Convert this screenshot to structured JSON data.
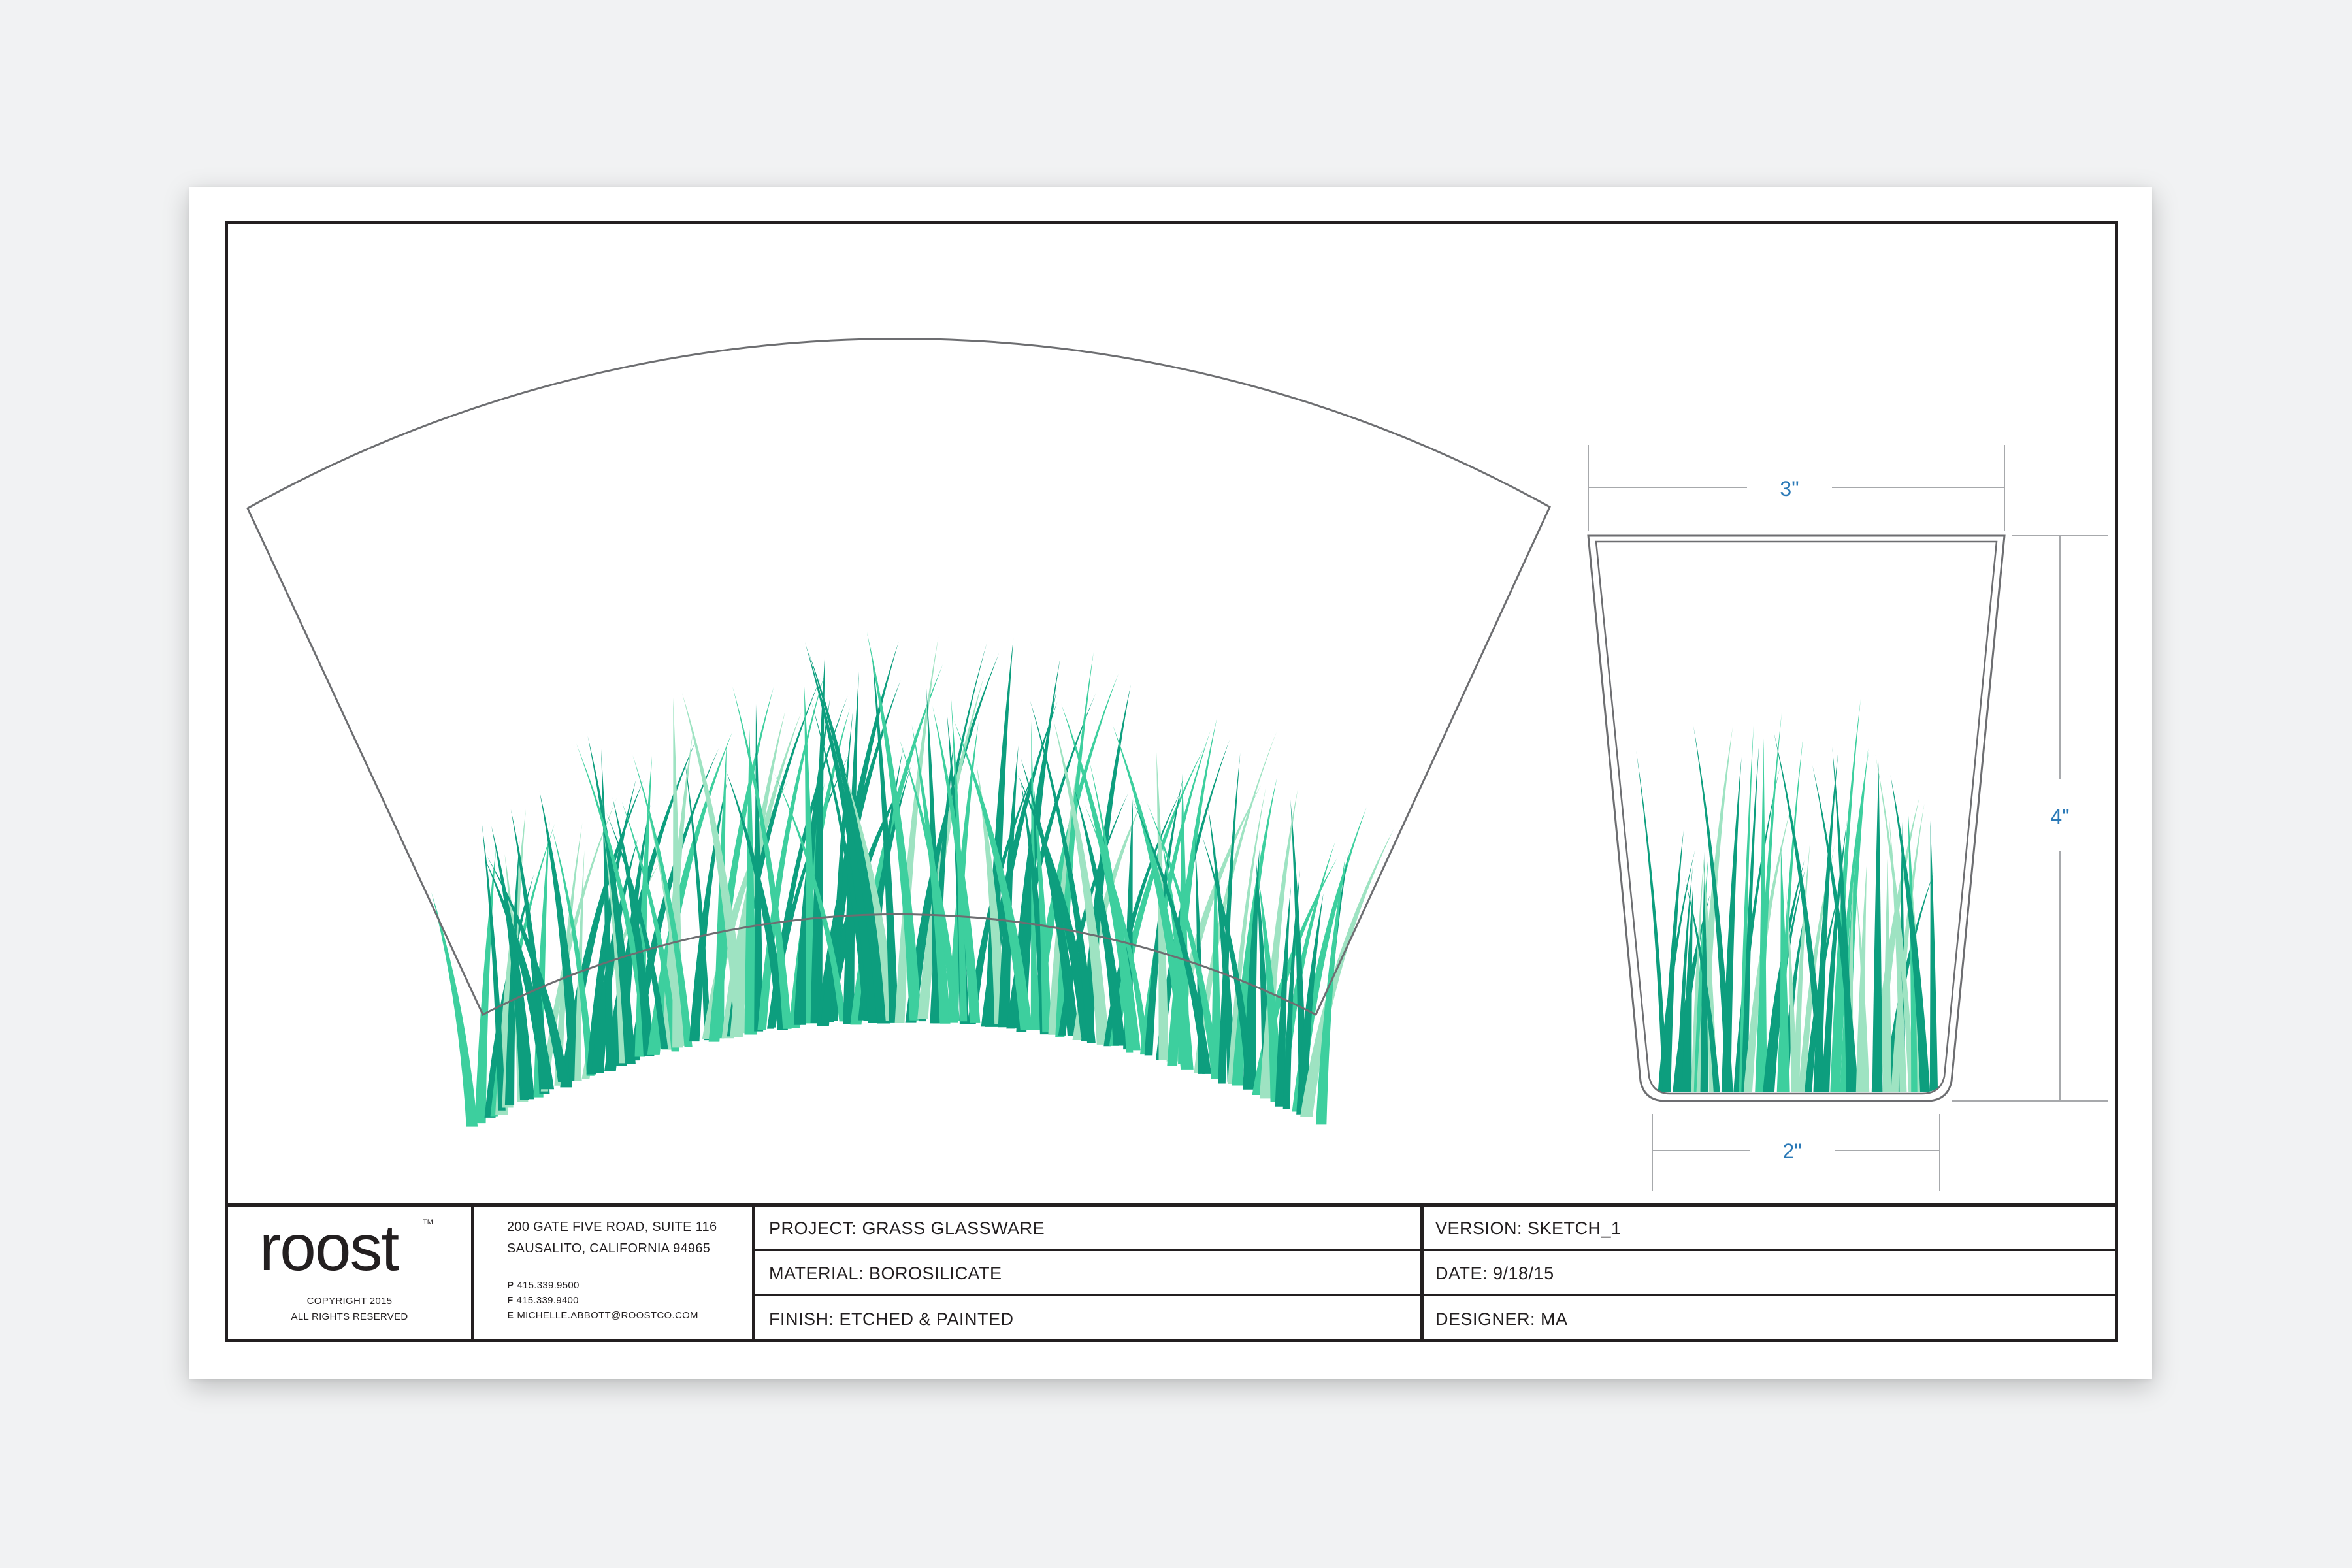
{
  "drawing": {
    "dimensions": {
      "top_width": "3\"",
      "height": "4\"",
      "bottom_width": "2\""
    },
    "colors": {
      "grass_dark": "#0d9e7e",
      "grass_medium": "#3dcf9e",
      "grass_light": "#9ee3c2",
      "outline": "#6d6e71",
      "dimension_line": "#a7a9ac",
      "dimension_text": "#2a79b7"
    }
  },
  "title_block": {
    "logo": "roost",
    "trademark": "TM",
    "copyright_line1": "COPYRIGHT 2015",
    "copyright_line2": "ALL RIGHTS RESERVED",
    "address_line1": "200 GATE FIVE ROAD, SUITE 116",
    "address_line2": "SAUSALITO, CALIFORNIA 94965",
    "phone_label": "P",
    "phone": "415.339.9500",
    "fax_label": "F",
    "fax": "415.339.9400",
    "email_label": "E",
    "email": "MICHELLE.ABBOTT@ROOSTCO.COM",
    "project": "PROJECT: GRASS GLASSWARE",
    "material": "MATERIAL: BOROSILICATE",
    "finish": "FINISH: ETCHED & PAINTED",
    "version": "VERSION: SKETCH_1",
    "date": "DATE: 9/18/15",
    "designer": "DESIGNER: MA"
  }
}
